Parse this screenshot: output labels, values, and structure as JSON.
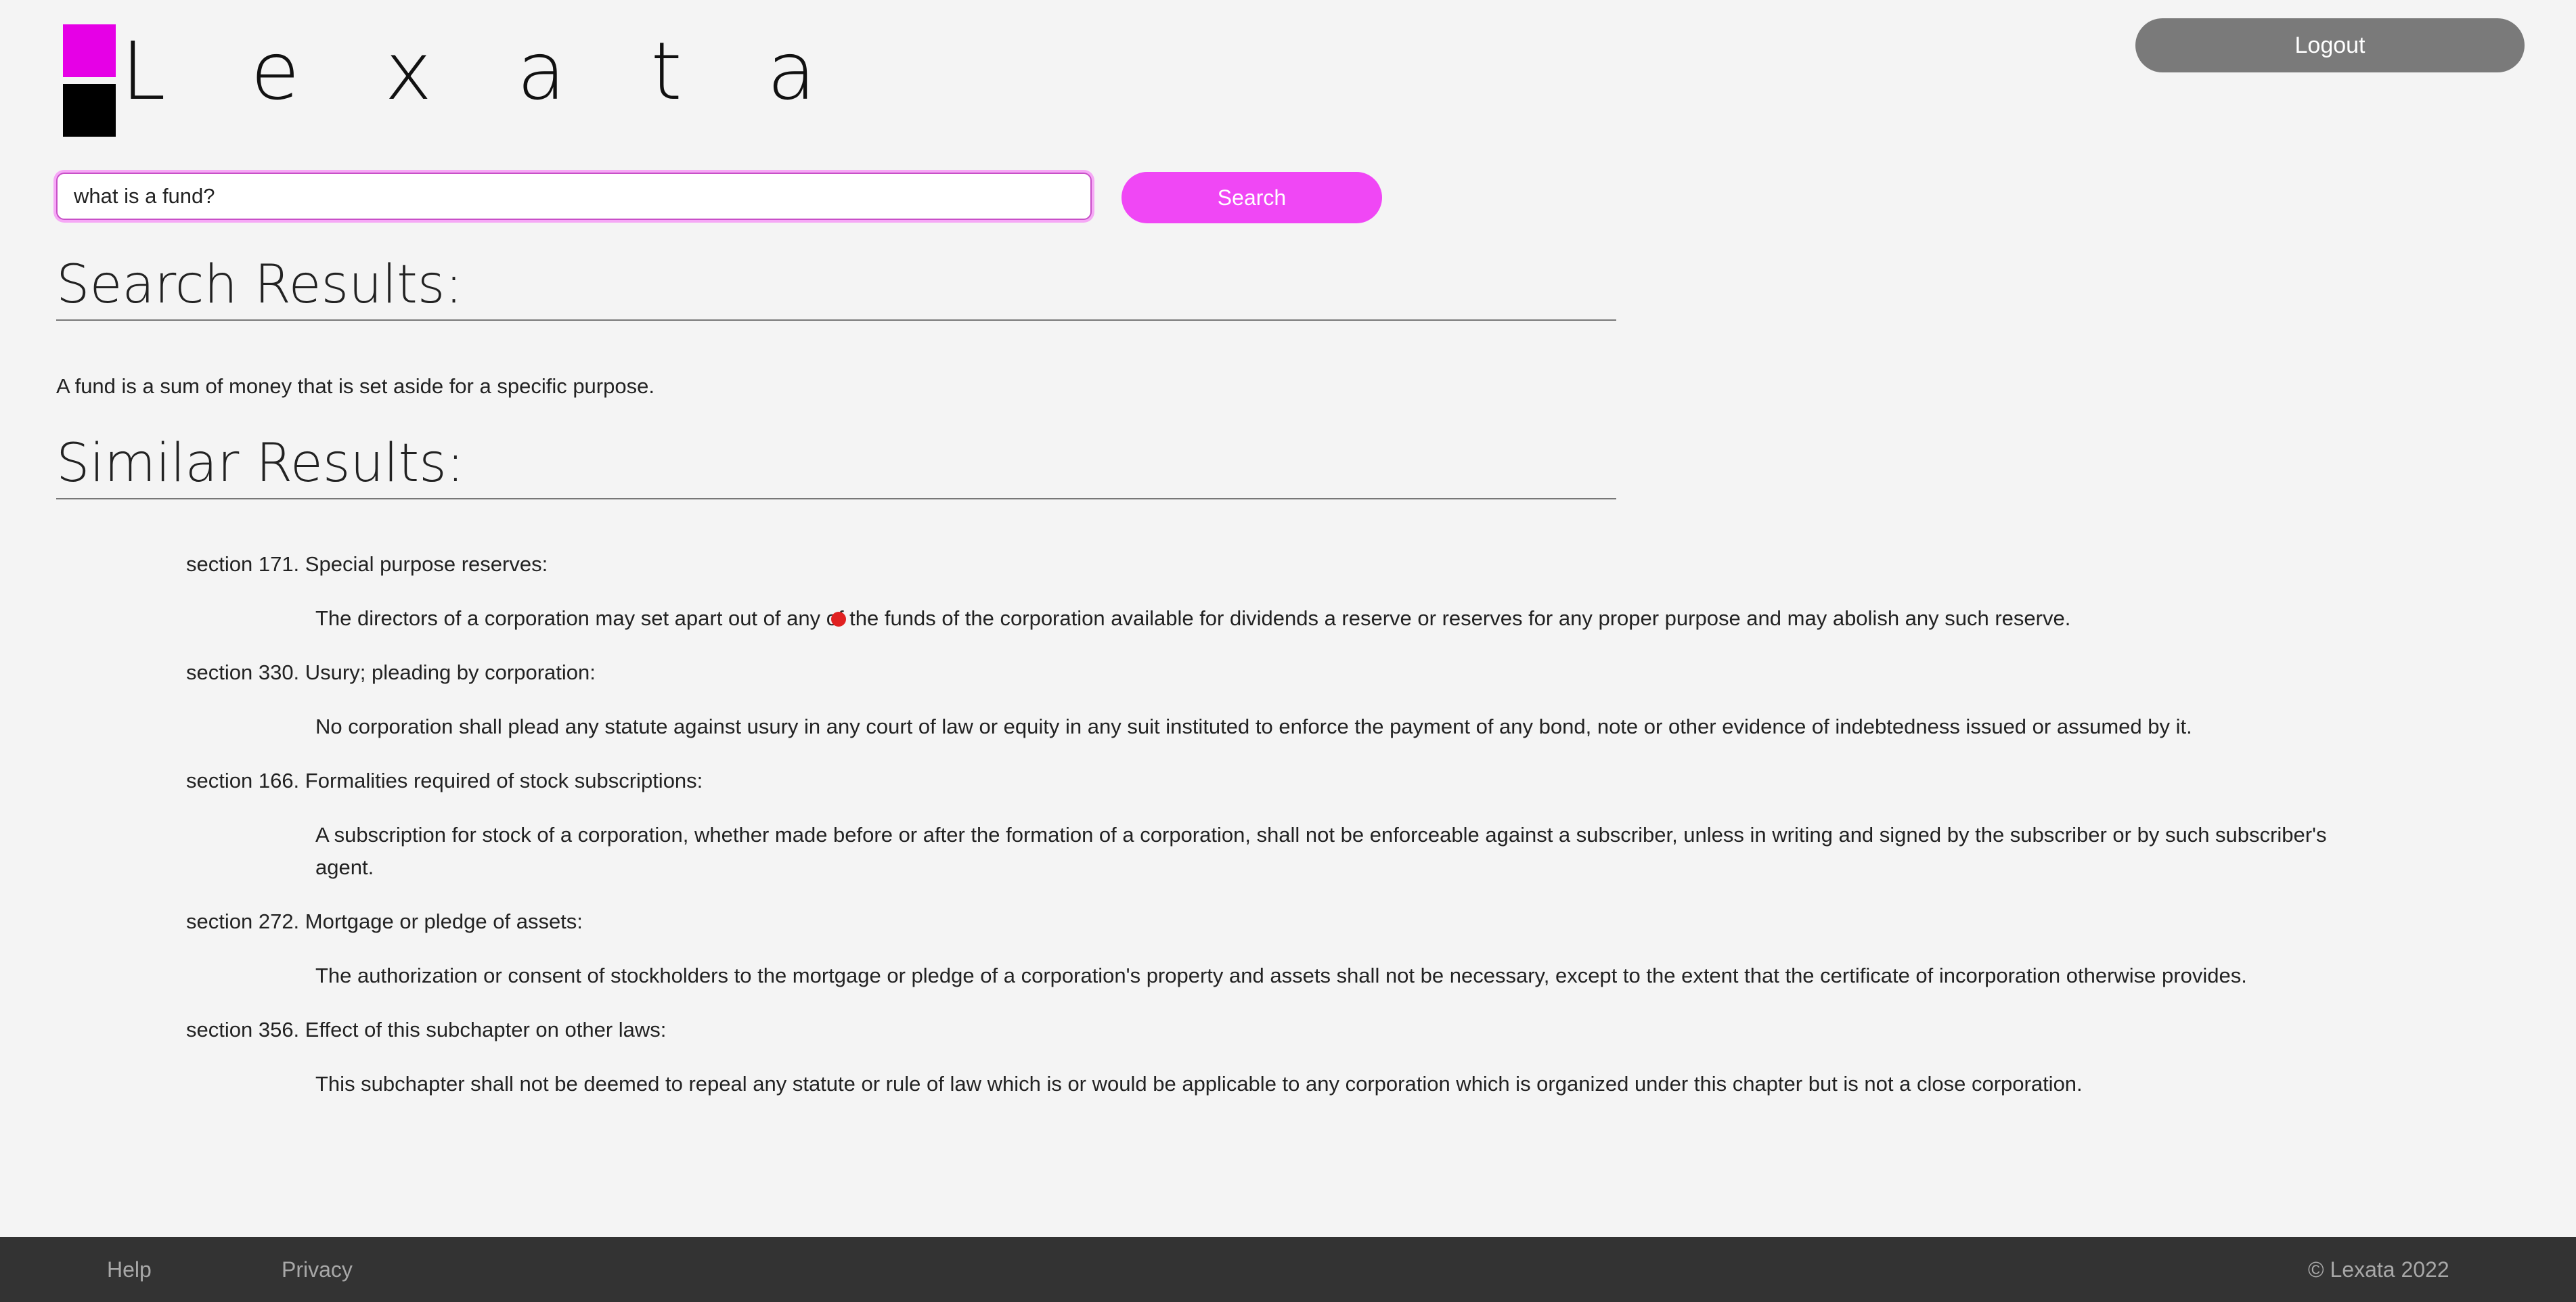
{
  "brand": {
    "name": "L e x a t a",
    "colors": {
      "accent_pink": "#e600e6",
      "logo_black": "#000000",
      "search_button": "#f047f5",
      "logout_button": "#7a7a7a",
      "footer_bg": "#333333"
    }
  },
  "header": {
    "logout_label": "Logout"
  },
  "search": {
    "query": "what is a fund?",
    "button_label": "Search"
  },
  "search_results": {
    "heading": "Search Results:",
    "answer": "A fund is a sum of money that is set aside for a specific purpose."
  },
  "similar_results": {
    "heading": "Similar Results:",
    "items": [
      {
        "title": "section 171. Special purpose reserves:",
        "text": "The directors of a corporation may set apart out of any of the funds of the corporation available for dividends a reserve or reserves for any proper purpose and may abolish any such reserve."
      },
      {
        "title": "section 330. Usury; pleading by corporation:",
        "text": "No corporation shall plead any statute against usury in any court of law or equity in any suit instituted to enforce the payment of any bond, note or other evidence of indebtedness issued or assumed by it."
      },
      {
        "title": "section 166. Formalities required of stock subscriptions:",
        "text": "A subscription for stock of a corporation, whether made before or after the formation of a corporation, shall not be enforceable against a subscriber, unless in writing and signed by the subscriber or by such subscriber's agent."
      },
      {
        "title": "section 272. Mortgage or pledge of assets:",
        "text": "The authorization or consent of stockholders to the mortgage or pledge of a corporation's property and assets shall not be necessary, except to the extent that the certificate of incorporation otherwise provides."
      },
      {
        "title": "section 356. Effect of this subchapter on other laws:",
        "text": "This subchapter shall not be deemed to repeal any statute or rule of law which is or would be applicable to any corporation which is organized under this chapter but is not a close corporation."
      }
    ]
  },
  "footer": {
    "help_label": "Help",
    "privacy_label": "Privacy",
    "copyright": "© Lexata 2022"
  }
}
